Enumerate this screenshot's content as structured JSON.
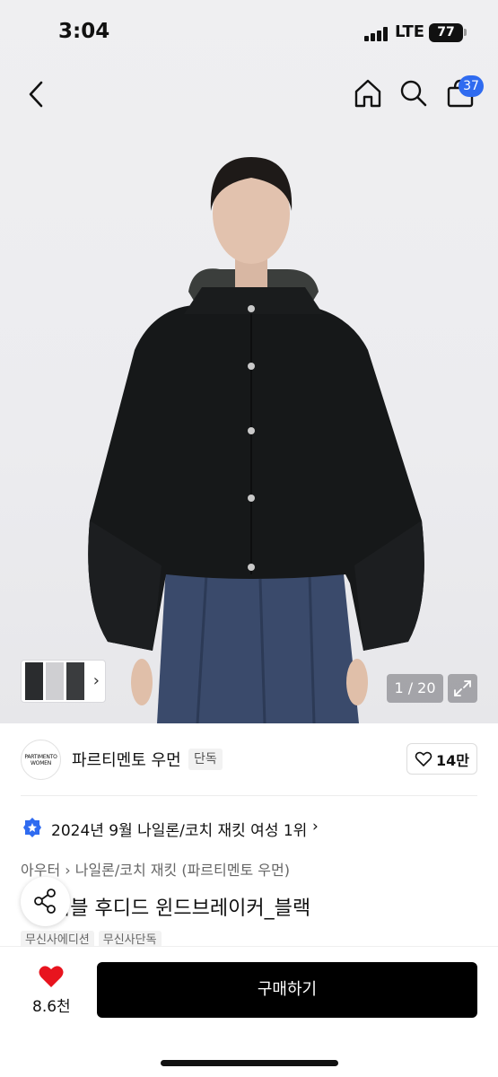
{
  "status_bar": {
    "time": "3:04",
    "network": "LTE",
    "battery": "77"
  },
  "nav": {
    "cart_count": "37",
    "icons": [
      "back-icon",
      "home-icon",
      "search-icon",
      "cart-icon"
    ]
  },
  "gallery": {
    "counter": "1 / 20",
    "thumbnail_chevron": "›"
  },
  "brand": {
    "logo_line1": "PARTIMENTO",
    "logo_line2": "WOMEN",
    "name": "파르티멘토 우먼",
    "tag": "단독",
    "likes": "14만"
  },
  "ranking": {
    "text": "2024년 9월 나일론/코치 재킷 여성 1위",
    "chevron": "›"
  },
  "breadcrumb": "아우터 › 나일론/코치 재킷 (파르티멘토 우먼)",
  "product": {
    "name": "시블 후디드 윈드브레이커_블랙",
    "tags": [
      "무신사에디션",
      "무신사단독"
    ]
  },
  "bottom": {
    "wishlist_count": "8.6천",
    "buy_label": "구매하기"
  },
  "colors": {
    "accent_badge": "#2f6bf0",
    "heart": "#e8141e",
    "buy_button": "#000000"
  }
}
